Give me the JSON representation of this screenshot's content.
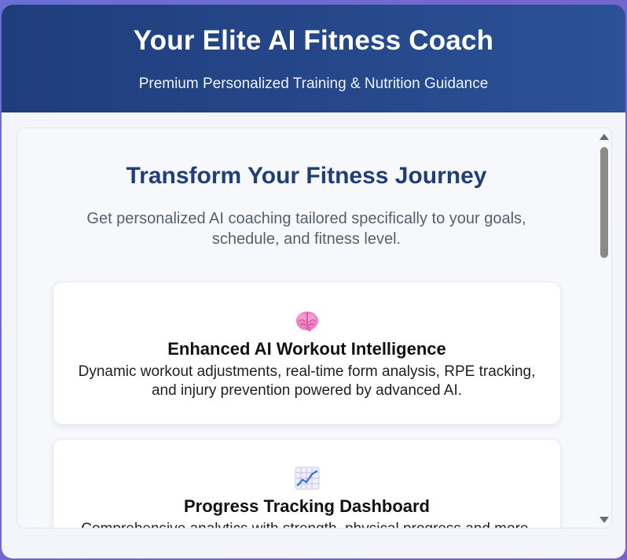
{
  "header": {
    "title": "Your Elite AI Fitness Coach",
    "subtitle": "Premium Personalized Training & Nutrition Guidance"
  },
  "intro": {
    "title": "Transform Your Fitness Journey",
    "text": "Get personalized AI coaching tailored specifically to your goals, schedule, and fitness level."
  },
  "features": [
    {
      "icon": "brain-icon",
      "title": "Enhanced AI Workout Intelligence",
      "text": "Dynamic workout adjustments, real-time form analysis, RPE tracking, and injury prevention powered by advanced AI."
    },
    {
      "icon": "chart-increasing-icon",
      "title": "Progress Tracking Dashboard",
      "text": "Comprehensive analytics with strength, physical progress and more."
    }
  ],
  "colors": {
    "header_start": "#1f3d7c",
    "header_end": "#2b5196",
    "accent_title": "#203e78",
    "background_gradient": "#6a6fd6"
  }
}
